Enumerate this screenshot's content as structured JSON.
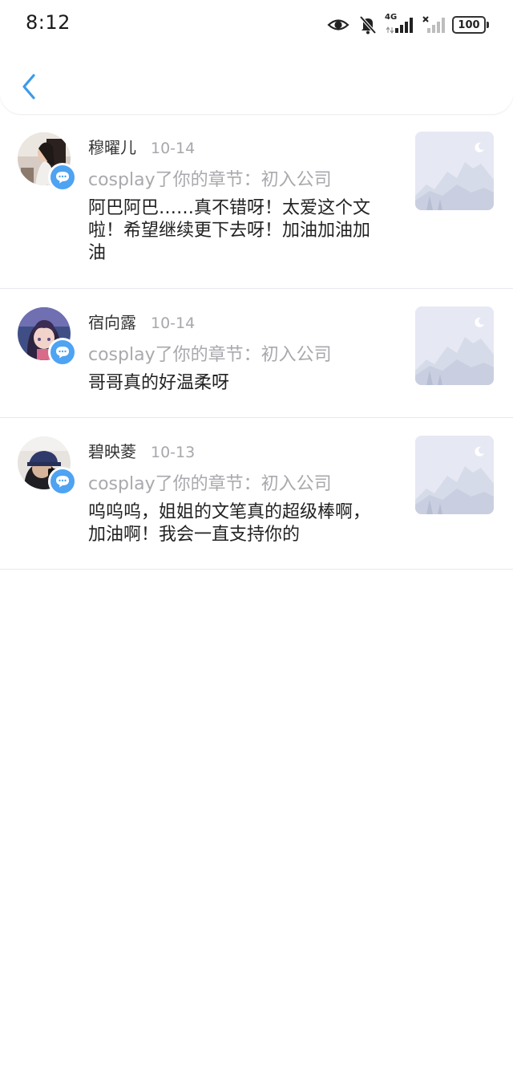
{
  "status_bar": {
    "time": "8:12",
    "network": "4G",
    "battery": "100",
    "icons": [
      "eye-icon",
      "bell-off-icon",
      "signal-4g-icon",
      "signal-no-sim-icon",
      "battery-icon"
    ]
  },
  "nav": {
    "back_icon": "chevron-left-icon",
    "accent_color": "#3d9be9"
  },
  "comments": [
    {
      "name": "穆曜儿",
      "date": "10-14",
      "context": "cosplay了你的章节：初入公司",
      "text": "阿巴阿巴……真不错呀！太爱这个文啦！希望继续更下去呀！加油加油加油",
      "avatar": "avatar-photo-girl",
      "badge_icon": "chat-bubble-icon",
      "thumbnail_icon": "mountain-placeholder-icon"
    },
    {
      "name": "宿向露",
      "date": "10-14",
      "context": "cosplay了你的章节：初入公司",
      "text": "哥哥真的好温柔呀",
      "avatar": "avatar-anime-girl",
      "badge_icon": "chat-bubble-icon",
      "thumbnail_icon": "mountain-placeholder-icon"
    },
    {
      "name": "碧映菱",
      "date": "10-13",
      "context": "cosplay了你的章节：初入公司",
      "text": "呜呜呜，姐姐的文笔真的超级棒啊，加油啊！我会一直支持你的",
      "avatar": "avatar-photo-cap",
      "badge_icon": "chat-bubble-icon",
      "thumbnail_icon": "mountain-placeholder-icon"
    }
  ]
}
